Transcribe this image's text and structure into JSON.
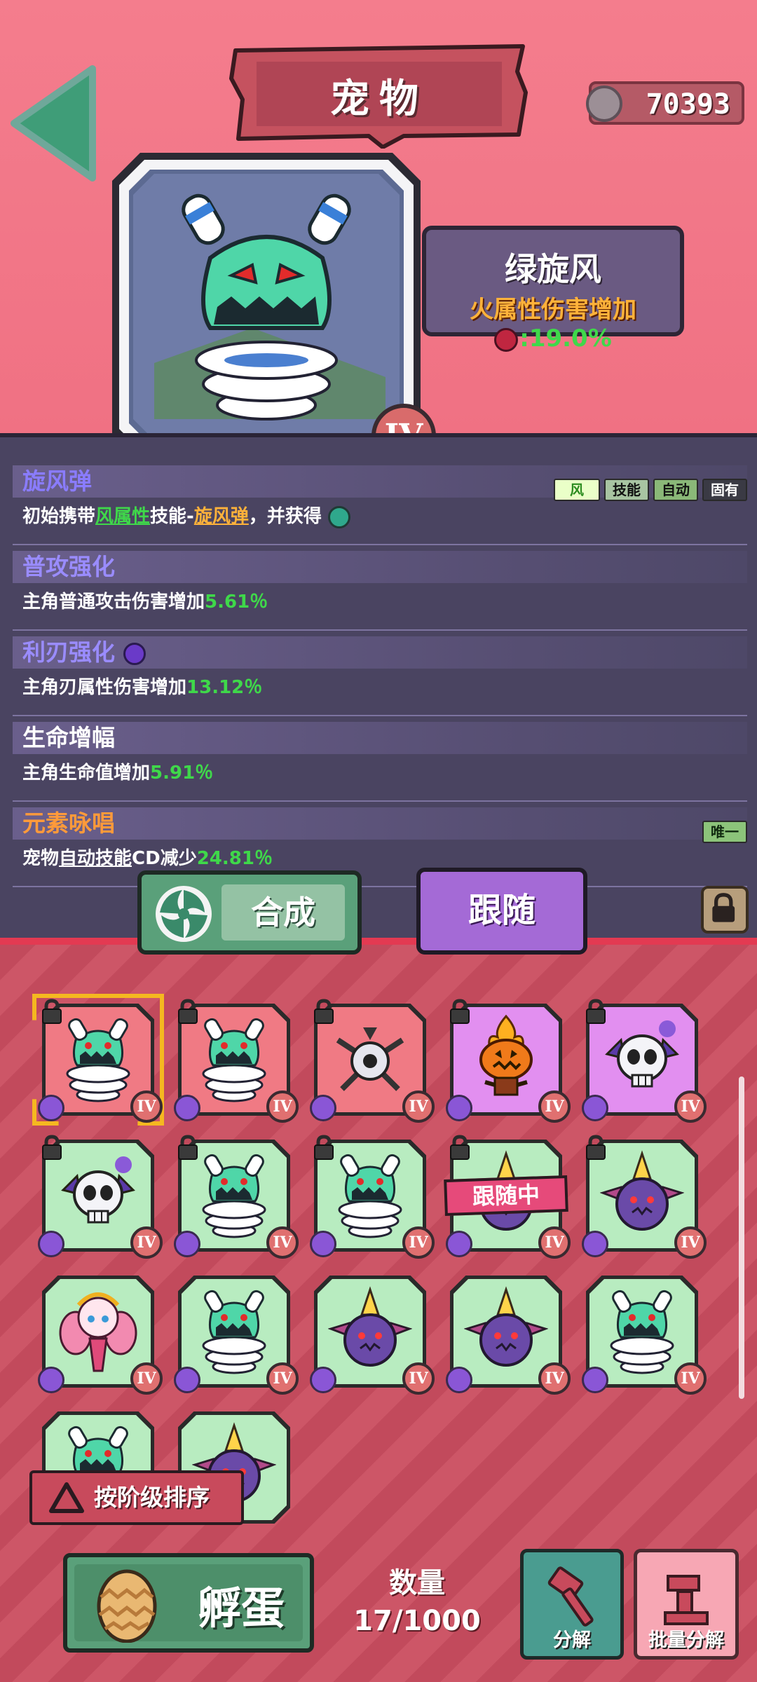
{
  "header": {
    "title": "宠物",
    "currency_value": "70393",
    "currency_icon": "gear-coin-icon"
  },
  "pet": {
    "name": "绿旋风",
    "attribute_label": "火属性伤害增加",
    "attribute_value": ":19.0%",
    "grade": "IV"
  },
  "skills": [
    {
      "title": "旋风弹",
      "title_color": "#8a7cff",
      "tags": [
        "风",
        "技能",
        "自动",
        "固有"
      ],
      "desc_parts": [
        "初始携带",
        "风属性",
        "技能-",
        "旋风弹",
        "，并获得"
      ]
    },
    {
      "title": "普攻强化",
      "title_color": "#9a8cff",
      "desc": "主角普通攻击伤害增加",
      "value": "5.61％"
    },
    {
      "title": "利刃强化",
      "title_color": "#9a8cff",
      "desc": "主角刃属性伤害增加",
      "value": "13.12％"
    },
    {
      "title": "生命增幅",
      "title_color": "#ffffff",
      "desc": "主角生命值增加",
      "value": "5.91％"
    },
    {
      "title": "元素咏唱",
      "title_color": "#ff9a3a",
      "tag": "唯一",
      "desc_prefix": "宠物",
      "desc_underlined": "自动技能",
      "desc_suffix": "CD减少",
      "value": "24.81％"
    }
  ],
  "actions": {
    "merge_label": "合成",
    "follow_label": "跟随"
  },
  "inventory": {
    "following_label": "跟随中",
    "grade_label": "IV",
    "items": [
      {
        "bg": "red",
        "art": "whirlwind",
        "locked": true,
        "selected": true
      },
      {
        "bg": "red",
        "art": "whirlwind",
        "locked": true
      },
      {
        "bg": "red",
        "art": "drone",
        "locked": true
      },
      {
        "bg": "purple",
        "art": "pumpkin",
        "locked": true
      },
      {
        "bg": "purple",
        "art": "skull",
        "locked": true
      },
      {
        "bg": "green",
        "art": "skull",
        "locked": true
      },
      {
        "bg": "green",
        "art": "whirlwind",
        "locked": true
      },
      {
        "bg": "green",
        "art": "whirlwind",
        "locked": true
      },
      {
        "bg": "green",
        "art": "horn",
        "locked": true,
        "following": true
      },
      {
        "bg": "green",
        "art": "horn",
        "locked": true
      },
      {
        "bg": "green",
        "art": "fairy"
      },
      {
        "bg": "green",
        "art": "whirlwind"
      },
      {
        "bg": "green",
        "art": "horn"
      },
      {
        "bg": "green",
        "art": "horn"
      },
      {
        "bg": "green",
        "art": "whirlwind"
      },
      {
        "bg": "green",
        "art": "whirlwind"
      },
      {
        "bg": "green",
        "art": "horn"
      }
    ]
  },
  "footer": {
    "sort_label": "按阶级排序",
    "hatch_label": "孵蛋",
    "count_label": "数量",
    "count_value": "17/1000",
    "decompose_label": "分解",
    "batch_decompose_label": "批量分解"
  }
}
